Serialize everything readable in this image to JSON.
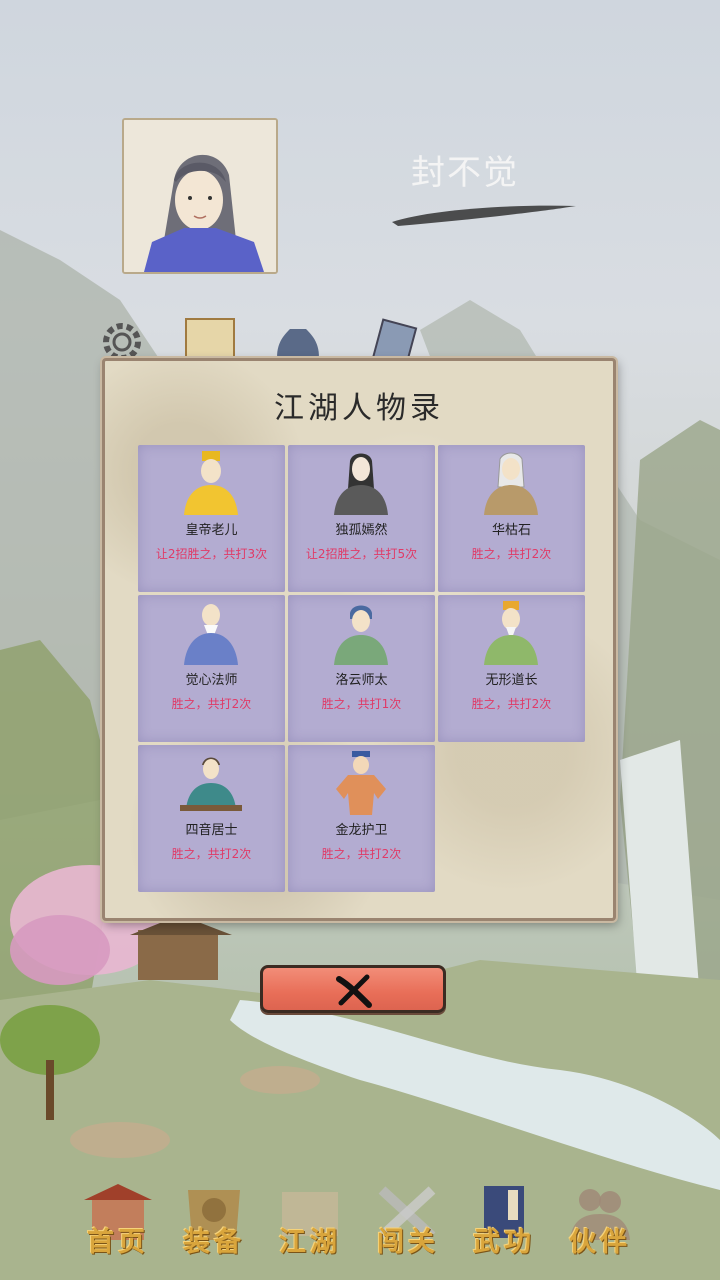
{
  "player": {
    "name": "封不觉"
  },
  "modal": {
    "title": "江湖人物录",
    "characters": [
      {
        "name": "皇帝老儿",
        "record": "让2招胜之，共打3次",
        "icon": "emperor-figure-icon",
        "color": "#f2c530"
      },
      {
        "name": "独孤嫣然",
        "record": "让2招胜之，共打5次",
        "icon": "long-haired-woman-figure-icon",
        "color": "#5a5a5a"
      },
      {
        "name": "华枯石",
        "record": "胜之，共打2次",
        "icon": "white-haired-elder-figure-icon",
        "color": "#b89a6a"
      },
      {
        "name": "觉心法师",
        "record": "胜之，共打2次",
        "icon": "bald-monk-figure-icon",
        "color": "#6a80c8"
      },
      {
        "name": "洛云师太",
        "record": "胜之，共打1次",
        "icon": "nun-figure-icon",
        "color": "#7aa87a"
      },
      {
        "name": "无形道长",
        "record": "胜之，共打2次",
        "icon": "taoist-figure-icon",
        "color": "#8fb86a"
      },
      {
        "name": "四音居士",
        "record": "胜之，共打2次",
        "icon": "musician-figure-icon",
        "color": "#3e8a8a"
      },
      {
        "name": "金龙护卫",
        "record": "胜之，共打2次",
        "icon": "guard-figure-icon",
        "color": "#e0905a"
      }
    ],
    "close_icon": "close-x-icon"
  },
  "nav": {
    "items": [
      {
        "label": "首页",
        "icon": "home-pavilion-icon"
      },
      {
        "label": "装备",
        "icon": "armor-icon"
      },
      {
        "label": "江湖",
        "icon": "scroll-map-icon"
      },
      {
        "label": "闯关",
        "icon": "crossed-swords-icon"
      },
      {
        "label": "武功",
        "icon": "martial-book-icon"
      },
      {
        "label": "伙伴",
        "icon": "companions-icon"
      }
    ]
  },
  "colors": {
    "card_bg": "#b3acd1",
    "record_text": "#e03a67",
    "nav_gold": "#d9a53c",
    "close_button": "#e86e58"
  }
}
